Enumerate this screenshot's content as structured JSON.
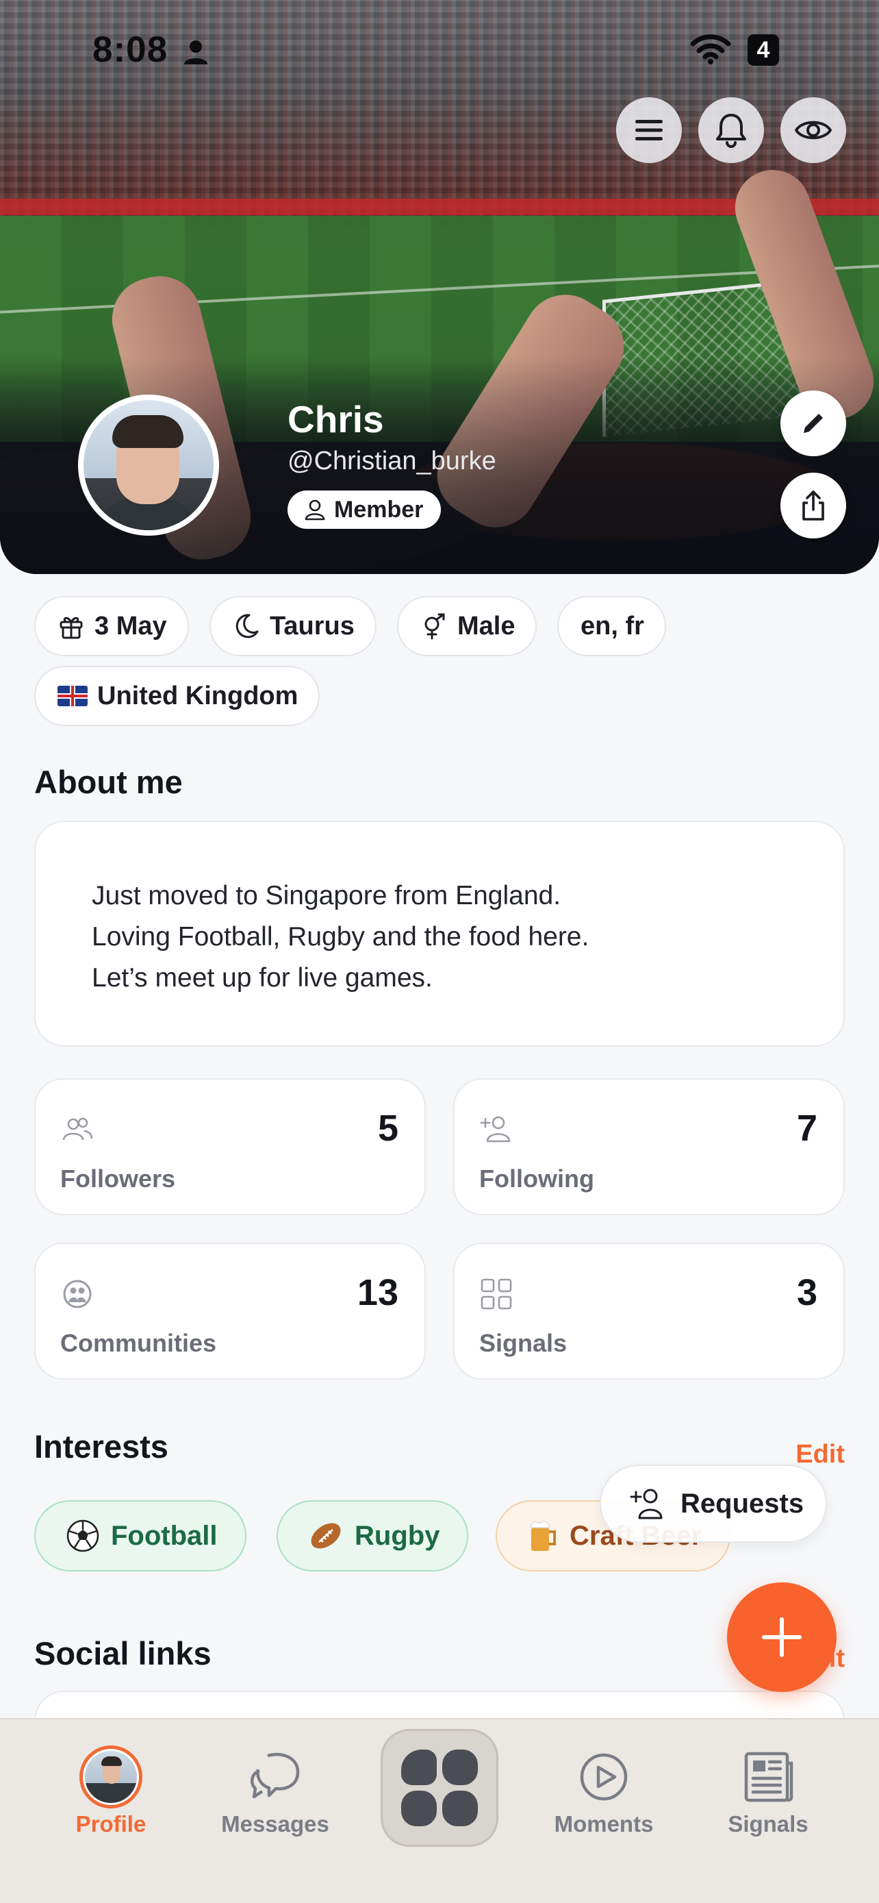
{
  "status_bar": {
    "time": "8:08",
    "battery": "4"
  },
  "profile": {
    "name": "Chris",
    "handle": "@Christian_burke",
    "badge": "Member"
  },
  "chips": {
    "birthday": "3 May",
    "zodiac": "Taurus",
    "gender": "Male",
    "languages": "en, fr",
    "country": "United Kingdom"
  },
  "about": {
    "title": "About me",
    "lines": [
      "Just moved to Singapore from England.",
      "Loving Football, Rugby and the food here.",
      "Let’s meet up for live games."
    ]
  },
  "stats": [
    {
      "label": "Followers",
      "value": "5",
      "icon": "followers-icon"
    },
    {
      "label": "Following",
      "value": "7",
      "icon": "add-person-icon"
    },
    {
      "label": "Communities",
      "value": "13",
      "icon": "communities-icon"
    },
    {
      "label": "Signals",
      "value": "3",
      "icon": "grid-icon"
    }
  ],
  "interests": {
    "title": "Interests",
    "edit_label": "Edit",
    "items": [
      {
        "label": "Football",
        "icon": "soccer-ball"
      },
      {
        "label": "Rugby",
        "icon": "rugby-ball"
      },
      {
        "label": "Craft Beer",
        "icon": "beer-mug"
      }
    ]
  },
  "requests_label": "Requests",
  "social_links": {
    "title": "Social links",
    "edit_label": "Edit"
  },
  "tabs": [
    {
      "label": "Profile",
      "active": true
    },
    {
      "label": "Messages"
    },
    {
      "label": "Moments"
    },
    {
      "label": "Signals"
    }
  ],
  "colors": {
    "accent": "#f26a35",
    "fab": "#f7622d",
    "green_chip": "#e9f7ef",
    "orange_chip": "#fdf3e8"
  }
}
